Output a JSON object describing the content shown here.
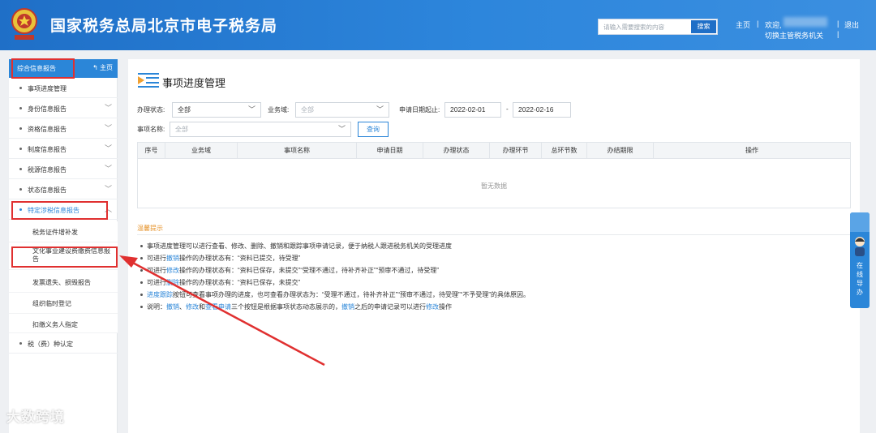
{
  "header": {
    "title": "国家税务总局北京市电子税务局",
    "search_placeholder": "请输入需要搜索的内容",
    "search_button": "搜索",
    "home_link": "主页",
    "welcome": "欢迎,",
    "switch_agency": "切换主管税务机关",
    "logout": "退出",
    "sep": "|"
  },
  "sidebar": {
    "title": "综合信息报告",
    "home": "主页",
    "items": [
      {
        "label": "事项进度管理"
      },
      {
        "label": "身份信息报告"
      },
      {
        "label": "资格信息报告"
      },
      {
        "label": "制度信息报告"
      },
      {
        "label": "税源信息报告"
      },
      {
        "label": "状态信息报告"
      },
      {
        "label": "特定涉税信息报告"
      }
    ],
    "subitems": [
      {
        "label": "税务证件增补发"
      },
      {
        "label": "文化事业建设费缴费信息报告"
      },
      {
        "label": "发票遗失、损毁报告"
      },
      {
        "label": "组织临时登记"
      },
      {
        "label": "扣缴义务人指定"
      }
    ],
    "last_item": {
      "label": "税（费）种认定"
    }
  },
  "main": {
    "title": "事项进度管理",
    "filters": {
      "status_label": "办理状态:",
      "status_value": "全部",
      "domain_label": "业务域:",
      "domain_value": "全部",
      "date_label": "申请日期起止:",
      "date_from": "2022-02-01",
      "date_dash": "-",
      "date_to": "2022-02-16",
      "name_label": "事项名称:",
      "name_value": "全部",
      "query_button": "查询"
    },
    "table": {
      "headers": [
        "序号",
        "业务域",
        "事项名称",
        "申请日期",
        "办理状态",
        "办理环节",
        "总环节数",
        "办结期限",
        "操作"
      ],
      "empty": "暂无数据"
    },
    "tips": {
      "title": "温馨提示",
      "lines": [
        {
          "text": "事项进度管理可以进行查看、修改、删除、撤销和跟踪事项申请记录，便于纳税人跟进税务机关的受理进度"
        },
        {
          "pre": "可进行",
          "link": "撤销",
          "post": "操作的办理状态有：“资料已提交，待受理”"
        },
        {
          "pre": "可进行",
          "link": "修改",
          "post": "操作的办理状态有：“资料已保存，未提交”“受理不通过，待补齐补正”“预审不通过，待受理”"
        },
        {
          "pre": "可进行",
          "link": "删除",
          "post": "操作的办理状态有：“资料已保存，未提交”"
        },
        {
          "pre": "",
          "link": "进度跟踪",
          "post": "按钮可查看事项办理的进度，也可查看办理状态为：“受理不通过，待补齐补正”“预审不通过，待受理”“不予受理”的具体原因。"
        }
      ],
      "note_pre": "说明：",
      "note_l1": "撤销",
      "note_sep1": "、",
      "note_l2": "修改",
      "note_mid": "和",
      "note_l3": "查看申请",
      "note_mid2": "三个按钮是根据事项状态动态展示的，",
      "note_l4": "撤销",
      "note_mid3": "之后的申请记录可以进行",
      "note_l5": "修改",
      "note_post": "操作"
    }
  },
  "float_tab": {
    "text": "在线导办"
  },
  "watermark": "大数跨境",
  "colors": {
    "primary": "#2b86d8",
    "header": "#1f6fc7",
    "highlight": "#e03030",
    "tip_title": "#e6932b"
  }
}
